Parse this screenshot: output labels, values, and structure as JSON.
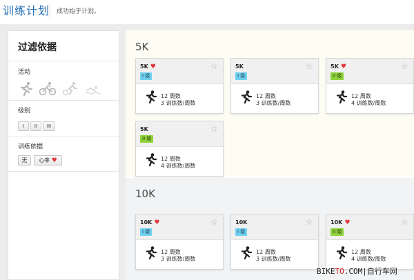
{
  "header": {
    "title": "训练计划",
    "subtitle": "成功始于计划。"
  },
  "sidebar": {
    "title": "过滤依据",
    "activity_label": "活动",
    "activity_icons": [
      "running-icon",
      "cycling-icon",
      "triathlon-icon",
      "swimming-icon"
    ],
    "level_label": "级别",
    "levels": [
      "I",
      "II",
      "III"
    ],
    "basis_label": "训练依据",
    "basis_options": [
      "无",
      "心率"
    ]
  },
  "sections": [
    {
      "title": "5K",
      "cards": [
        {
          "name": "5K",
          "heart": true,
          "level": "I 级",
          "weeks": "12 周数",
          "per_week": "3 训练数/周数"
        },
        {
          "name": "5K",
          "heart": false,
          "level": "I 级",
          "weeks": "12 周数",
          "per_week": "3 训练数/周数"
        },
        {
          "name": "5K",
          "heart": true,
          "level": "II 级",
          "weeks": "12 周数",
          "per_week": "4 训练数/周数"
        },
        {
          "name": "5K",
          "heart": false,
          "level": "II 级",
          "weeks": "12 周数",
          "per_week": "4 训练数/周数"
        }
      ]
    },
    {
      "title": "10K",
      "cards": [
        {
          "name": "10K",
          "heart": true,
          "level": "I 级",
          "weeks": "12 周数",
          "per_week": "3 训练数/周数"
        },
        {
          "name": "10K",
          "heart": false,
          "level": "I 级",
          "weeks": "12 周数",
          "per_week": "3 训练数/周数"
        },
        {
          "name": "10K",
          "heart": true,
          "level": "II 级",
          "weeks": "12 周数",
          "per_week": "4 训练数/周数"
        }
      ]
    }
  ],
  "watermark": {
    "part1": "BIKE",
    "part2": "TO",
    "part3": ".COM|自行车网"
  },
  "colors": {
    "title_blue": "#2a73b8",
    "level1_badge": "#6fd0ef",
    "level2_badge": "#8fd23c",
    "heart_red": "#e0373f"
  }
}
